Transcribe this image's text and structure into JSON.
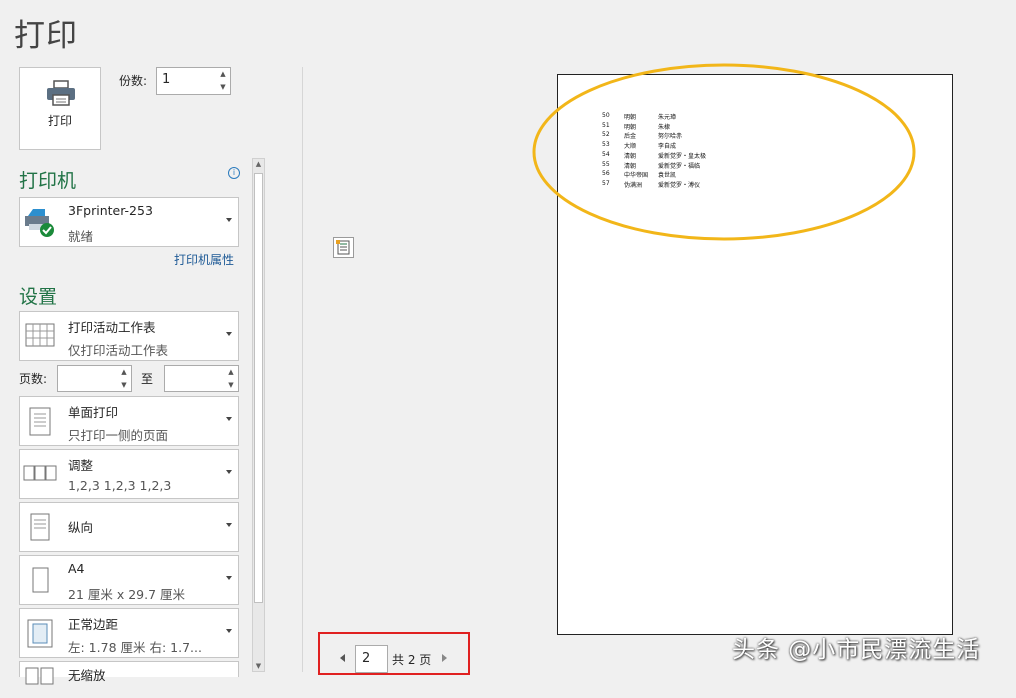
{
  "title": "打印",
  "print_button": {
    "label": "打印",
    "icon": "printer-icon"
  },
  "copies": {
    "label": "份数:",
    "value": "1"
  },
  "printer_section": {
    "heading": "打印机",
    "printer": {
      "name": "3Fprinter-253",
      "status": "就绪",
      "icon": "printer-ready-icon"
    },
    "properties_link": "打印机属性"
  },
  "settings_section": {
    "heading": "设置",
    "items": [
      {
        "title": "打印活动工作表",
        "subtitle": "仅打印活动工作表",
        "icon": "worksheet-grid-icon"
      },
      {
        "title": "单面打印",
        "subtitle": "只打印一侧的页面",
        "icon": "single-sided-icon"
      },
      {
        "title": "调整",
        "subtitle": "1,2,3    1,2,3    1,2,3",
        "icon": "collate-icon"
      },
      {
        "title": "纵向",
        "subtitle": "",
        "icon": "portrait-icon"
      },
      {
        "title": "A4",
        "subtitle": "21 厘米 x 29.7 厘米",
        "icon": "paper-size-icon"
      },
      {
        "title": "正常边距",
        "subtitle": "左: 1.78 厘米    右: 1.7...",
        "icon": "margins-icon"
      },
      {
        "title": "无缩放",
        "subtitle": "",
        "icon": "scaling-icon"
      }
    ],
    "pages": {
      "label": "页数:",
      "from": "",
      "to_label": "至",
      "to": ""
    }
  },
  "preview": {
    "rows": [
      [
        "50",
        "明朝",
        "朱元璋"
      ],
      [
        "51",
        "明朝",
        "朱棣"
      ],
      [
        "52",
        "后金",
        "努尔哈赤"
      ],
      [
        "53",
        "大顺",
        "李自成"
      ],
      [
        "54",
        "清朝",
        "爱新觉罗・皇太极"
      ],
      [
        "55",
        "清朝",
        "爱新觉罗・福临"
      ],
      [
        "56",
        "中华帝国",
        "袁世凯"
      ],
      [
        "57",
        "伪满洲",
        "爱新觉罗・溥仪"
      ]
    ]
  },
  "page_nav": {
    "current": "2",
    "total_label": "共 2 页"
  },
  "watermark": "头条 @小市民漂流生活",
  "colors": {
    "accent": "#217346",
    "annotation_circle": "#f2b619",
    "highlight_box": "#e02020"
  }
}
